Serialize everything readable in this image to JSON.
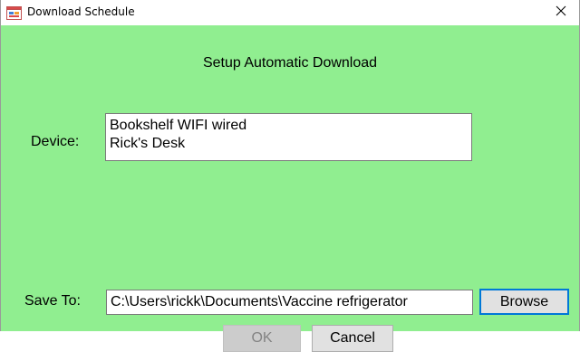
{
  "window": {
    "title": "Download Schedule",
    "close_glyph": "✕"
  },
  "dialog": {
    "heading": "Setup Automatic Download",
    "device_label": "Device:",
    "devices": [
      "Bookshelf WIFI wired",
      "Rick's Desk"
    ],
    "save_to_label": "Save To:",
    "save_path_value": "C:\\Users\\rickk\\Documents\\Vaccine refrigerator",
    "browse_label": "Browse",
    "ok_label": "OK",
    "cancel_label": "Cancel"
  },
  "icons": {
    "app": "app-form-icon",
    "close": "close-icon"
  },
  "colors": {
    "client_background": "#90ee90",
    "titlebar_background": "#ffffff",
    "focus_border": "#0078d7",
    "disabled_text": "#838383"
  }
}
